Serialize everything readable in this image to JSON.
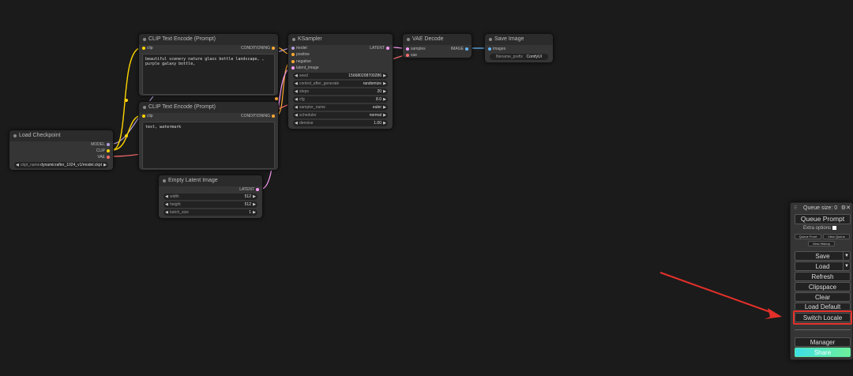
{
  "nodes": {
    "load_checkpoint": {
      "title": "Load Checkpoint",
      "outputs": [
        "MODEL",
        "CLIP",
        "VAE"
      ],
      "ckpt_label": "ckpt_name",
      "ckpt_value": "dynamicrafter_1024_v1/model.ckpt"
    },
    "clip_pos": {
      "title": "CLIP Text Encode (Prompt)",
      "input": "clip",
      "output": "CONDITIONING",
      "text": "beautiful scenery nature glass bottle landscape, , purple galaxy bottle,"
    },
    "clip_neg": {
      "title": "CLIP Text Encode (Prompt)",
      "input": "clip",
      "output": "CONDITIONING",
      "text": "text, watermark"
    },
    "ksampler": {
      "title": "KSampler",
      "inputs": [
        "model",
        "positive",
        "negative",
        "latent_image"
      ],
      "output": "LATENT",
      "widgets": [
        {
          "label": "seed",
          "value": "156680208700286"
        },
        {
          "label": "control_after_generate",
          "value": "randomize"
        },
        {
          "label": "steps",
          "value": "20"
        },
        {
          "label": "cfg",
          "value": "8.0"
        },
        {
          "label": "sampler_name",
          "value": "euler"
        },
        {
          "label": "scheduler",
          "value": "normal"
        },
        {
          "label": "denoise",
          "value": "1.00"
        }
      ]
    },
    "vae_decode": {
      "title": "VAE Decode",
      "inputs": [
        "samples",
        "vae"
      ],
      "output": "IMAGE"
    },
    "save_image": {
      "title": "Save Image",
      "input": "images",
      "widget_label": "filename_prefix",
      "widget_value": "ComfyUI"
    },
    "empty_latent": {
      "title": "Empty Latent Image",
      "output": "LATENT",
      "widgets": [
        {
          "label": "width",
          "value": "512"
        },
        {
          "label": "height",
          "value": "512"
        },
        {
          "label": "batch_size",
          "value": "1"
        }
      ]
    }
  },
  "menu": {
    "queue_size": "Queue size: 0",
    "queue_prompt": "Queue Prompt",
    "extra_options": "Extra options",
    "queue_front": "Queue Front",
    "view_queue": "View Queue",
    "view_history": "View History",
    "save": "Save",
    "load": "Load",
    "refresh": "Refresh",
    "clipspace": "Clipspace",
    "clear": "Clear",
    "load_default": "Load Default",
    "switch_locale": "Switch Locale",
    "manager": "Manager",
    "share": "Share"
  },
  "colors": {
    "highlight": "#e4302a",
    "share": "#5ee6a0"
  }
}
